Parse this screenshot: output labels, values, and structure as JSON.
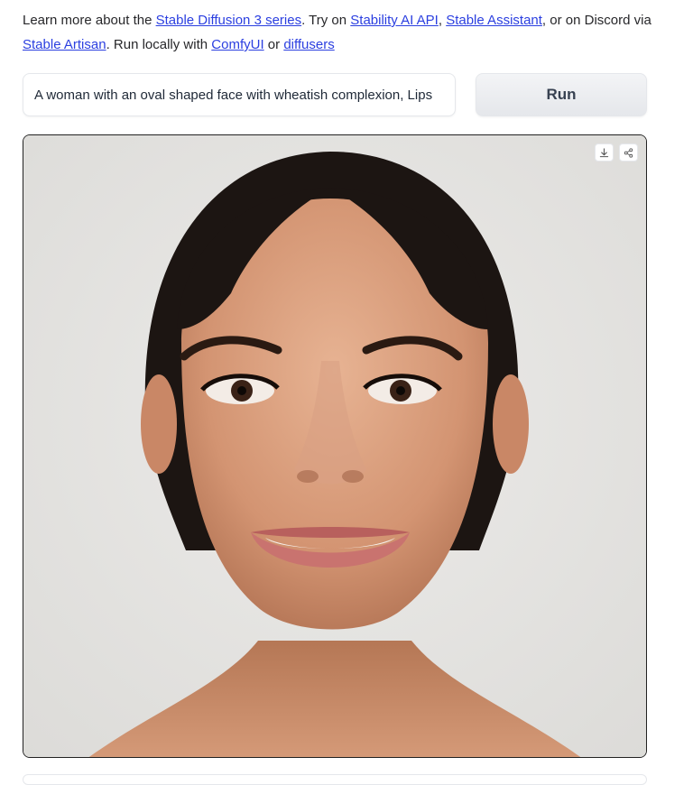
{
  "intro": {
    "t1": "Learn more about the ",
    "link_sd3": "Stable Diffusion 3 series",
    "t2": ". Try on ",
    "link_api": "Stability AI API",
    "t3": ", ",
    "link_assistant": "Stable Assistant",
    "t4": ", or on Discord via ",
    "link_artisan": "Stable Artisan",
    "t5": ". Run locally with ",
    "link_comfy": "ComfyUI",
    "t6": " or ",
    "link_diffusers": "diffusers"
  },
  "prompt": {
    "value": "A woman with an oval shaped face with wheatish complexion, Lips"
  },
  "run_button": {
    "label": "Run"
  },
  "result": {
    "icons": [
      "download-icon",
      "share-icon"
    ]
  },
  "colors": {
    "link": "#2b3fe0",
    "background": "#e4e3e1",
    "skin": "#d99a76",
    "hair": "#1c1512"
  }
}
